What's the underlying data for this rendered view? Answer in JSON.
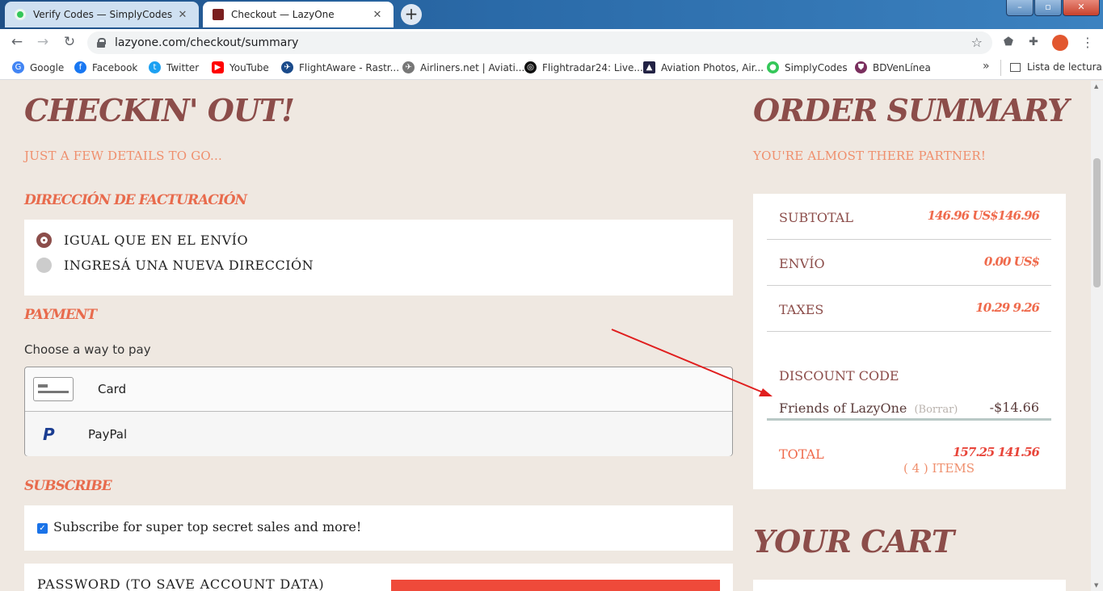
{
  "browser": {
    "tabs": [
      {
        "title": "Verify Codes — SimplyCodes",
        "close": "✕"
      },
      {
        "title": "Checkout — LazyOne",
        "close": "✕"
      }
    ],
    "new_tab": "+",
    "url": "lazyone.com/checkout/summary",
    "bookmarks": [
      {
        "label": "Google",
        "icon": "google-icon",
        "color": "#4285f4"
      },
      {
        "label": "Facebook",
        "icon": "facebook-icon",
        "color": "#1877f2"
      },
      {
        "label": "Twitter",
        "icon": "twitter-icon",
        "color": "#1da1f2"
      },
      {
        "label": "YouTube",
        "icon": "youtube-icon",
        "color": "#ff0000"
      },
      {
        "label": "FlightAware - Rastr...",
        "icon": "plane-icon",
        "color": "#1a4a8a"
      },
      {
        "label": "Airliners.net | Aviati...",
        "icon": "airliners-icon",
        "color": "#777777"
      },
      {
        "label": "Flightradar24: Live...",
        "icon": "radar-icon",
        "color": "#111111"
      },
      {
        "label": "Aviation Photos, Air...",
        "icon": "photo-icon",
        "color": "#222244"
      },
      {
        "label": "SimplyCodes",
        "icon": "simplycodes-icon",
        "color": "#34c759"
      },
      {
        "label": "BDVenLínea",
        "icon": "shield-icon",
        "color": "#7a2f5e"
      }
    ],
    "more_bookmarks": "»",
    "reading_list": "Lista de lectura"
  },
  "checkout": {
    "title": "Checkin' Out!",
    "subtitle": "Just a few details to go...",
    "billing": {
      "heading": "Dirección de facturación",
      "options": [
        {
          "label": "IGUAL QUE EN EL ENVÍO",
          "selected": true
        },
        {
          "label": "INGRESÁ UNA NUEVA DIRECCIÓN",
          "selected": false
        }
      ]
    },
    "payment": {
      "heading": "Payment",
      "prompt": "Choose a way to pay",
      "methods": [
        {
          "label": "Card",
          "icon": "credit-card-icon"
        },
        {
          "label": "PayPal",
          "icon": "paypal-icon"
        }
      ]
    },
    "subscribe": {
      "heading": "Subscribe",
      "label": "Subscribe for super top secret sales and more!",
      "checked": true
    },
    "password_label": "PASSWORD (TO SAVE ACCOUNT DATA)"
  },
  "summary": {
    "title": "Order Summary",
    "subtitle": "You're almost there partner!",
    "rows": [
      {
        "label": "Subtotal",
        "value": "146.96 US$146.96"
      },
      {
        "label": "Envío",
        "value": "0.00 US$"
      },
      {
        "label": "Taxes",
        "value": "10.29 9.26"
      }
    ],
    "discount": {
      "label": "Discount Code",
      "code": "Friends of LazyOne",
      "remove": "(Borrar)",
      "amount": "-$14.66"
    },
    "total": {
      "label": "Total",
      "value": "157.25 141.56"
    }
  },
  "cart": {
    "title": "Your Cart",
    "count": "( 4 ) ITEMS"
  },
  "colors": {
    "heading_brown": "#8c4d4a",
    "accent_orange": "#ef8f6d",
    "accent_red": "#e8453a",
    "page_bg": "#efe8e1"
  }
}
